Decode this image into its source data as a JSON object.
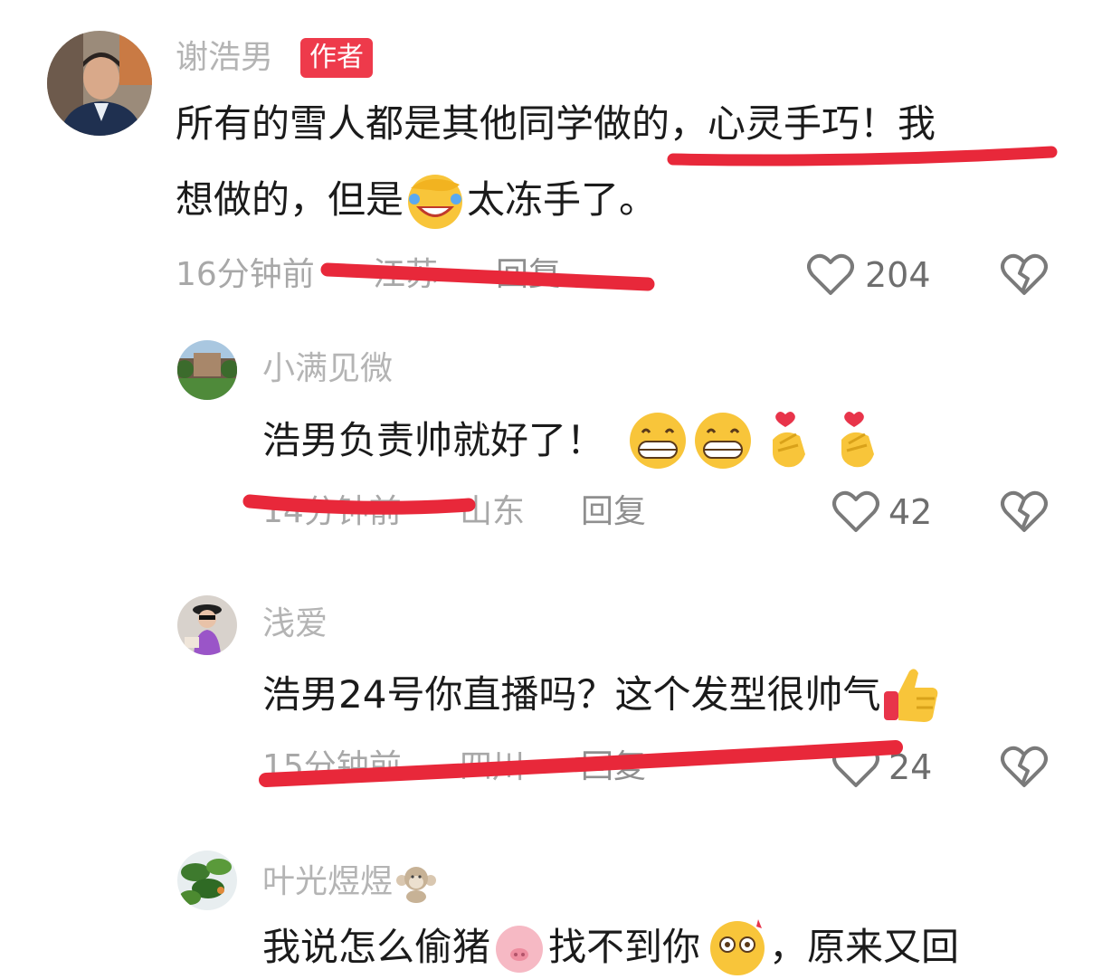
{
  "comments": [
    {
      "username": "谢浩男",
      "badge": "作者",
      "text_line1": "所有的雪人都是其他同学做的，心灵手巧！我",
      "text_line2_a": "想做的，但是",
      "text_line2_b": "太冻手了。",
      "time": "16分钟前",
      "location": "江苏",
      "reply_label": "回复",
      "likes": "204",
      "emoji": "facepalm-laugh"
    },
    {
      "username": "小满见微",
      "text": "浩男负责帅就好了！",
      "emojis": [
        "grin",
        "grin",
        "finger-heart",
        "finger-heart"
      ],
      "time": "14分钟前",
      "location": "山东",
      "reply_label": "回复",
      "likes": "42"
    },
    {
      "username": "浅爱",
      "text": "浩男24号你直播吗？这个发型很帅气",
      "emojis": [
        "thumbs-up"
      ],
      "time": "15分钟前",
      "location": "四川",
      "reply_label": "回复",
      "likes": "24"
    },
    {
      "username": "叶光煜煜",
      "username_emoji": "monkey",
      "text_a": "我说怎么偷猪",
      "text_b": "找不到你",
      "text_c": "，原来又回"
    }
  ],
  "colors": {
    "badge": "#ee3a4b",
    "annotation_red": "#e8283a",
    "secondary_text": "#a8a8a8"
  }
}
